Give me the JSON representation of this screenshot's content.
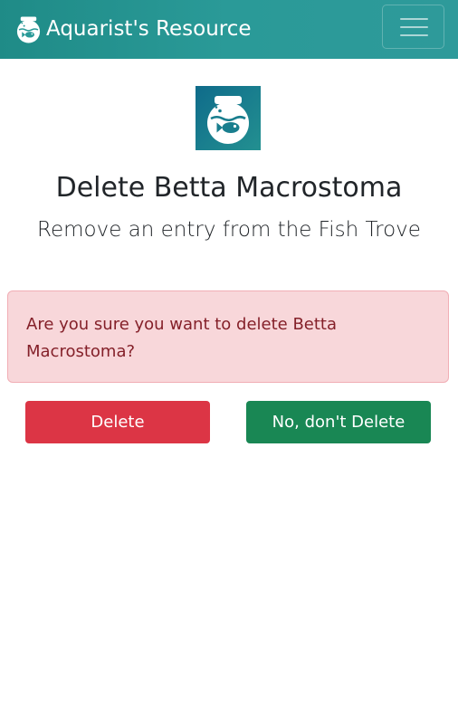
{
  "navbar": {
    "brand_text": "Aquarist's Resource",
    "brand_icon": "fishbowl-icon",
    "toggler_icon": "hamburger-menu-icon",
    "background_color": "#2a9a98"
  },
  "page": {
    "logo_icon": "fishbowl-icon",
    "title": "Delete Betta Macrostoma",
    "subtitle": "Remove an entry from the Fish Trove"
  },
  "alert": {
    "message": "Are you sure you want to delete Betta Macrostoma?",
    "background_color": "#f8d7da",
    "text_color": "#842029"
  },
  "actions": {
    "delete_label": "Delete",
    "delete_color": "#dc3545",
    "cancel_label": "No, don't Delete",
    "cancel_color": "#198754"
  }
}
